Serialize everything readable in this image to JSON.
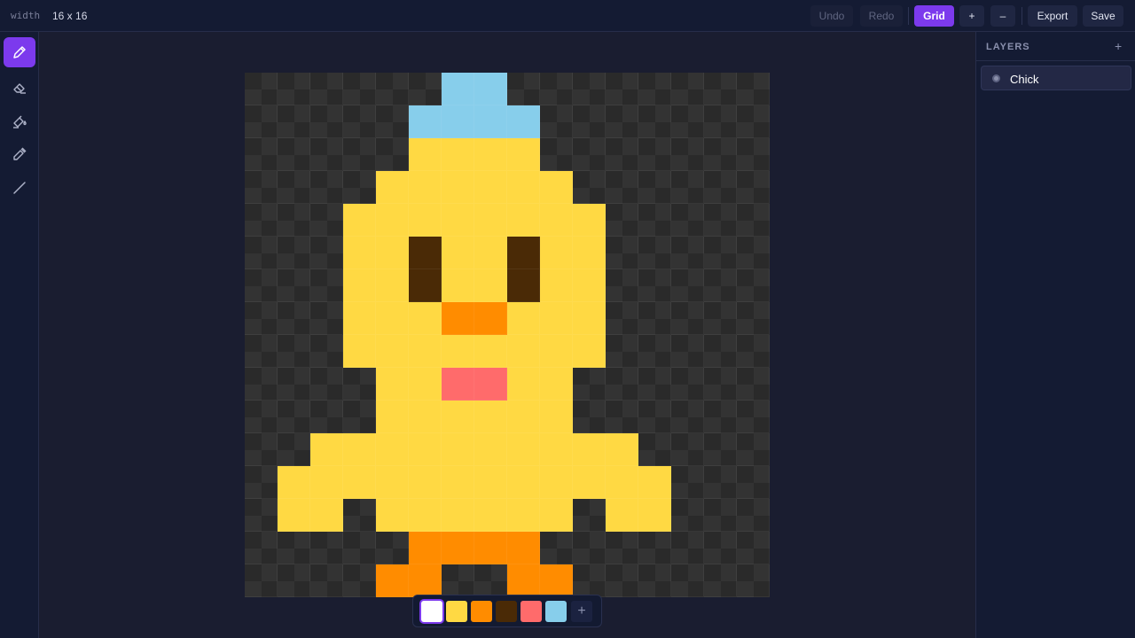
{
  "topbar": {
    "size_label": "width",
    "size_value": "16 x 16",
    "undo_label": "Undo",
    "redo_label": "Redo",
    "grid_label": "Grid",
    "zoom_in_label": "+",
    "zoom_out_label": "–",
    "export_label": "Export",
    "save_label": "Save"
  },
  "tools": [
    {
      "name": "pencil-tool",
      "icon": "pencil-icon",
      "active": true
    },
    {
      "name": "eraser-tool",
      "icon": "eraser-icon",
      "active": false
    },
    {
      "name": "fill-tool",
      "icon": "paint-bucket-icon",
      "active": false
    },
    {
      "name": "eyedropper-tool",
      "icon": "eyedropper-icon",
      "active": false
    },
    {
      "name": "line-tool",
      "icon": "line-icon",
      "active": false
    }
  ],
  "canvas": {
    "grid_size": 16,
    "colors": {
      "Y": "#ffd943",
      "O": "#ff8c00",
      "D": "#4a2a06",
      "P": "#ff6b6b",
      "B": "#87ceeb"
    },
    "pixels": [
      "......BB........",
      ".....BBBB.......",
      ".....YYYY.......",
      "....YYYYYY......",
      "...YYYYYYYY.....",
      "...YYDYYDYY.....",
      "...YYDYYDYY.....",
      "...YYYOOYYY.....",
      "...YYYYYYYY.....",
      "....YYPPYY......",
      "....YYYYYY......",
      "..YYYYYYYYYY....",
      ".YYYYYYYYYYYY...",
      ".YY.YYYYYY.YY...",
      ".....OOOO.......",
      "....OO..OO......"
    ]
  },
  "palette": {
    "colors": [
      "#ffffff",
      "#ffd943",
      "#ff8c00",
      "#4a2a06",
      "#ff6b6b",
      "#87ceeb"
    ],
    "selected_index": 0,
    "add_label": "+"
  },
  "layers": {
    "title": "LAYERS",
    "add_label": "+",
    "items": [
      {
        "name": "Chick"
      }
    ]
  }
}
